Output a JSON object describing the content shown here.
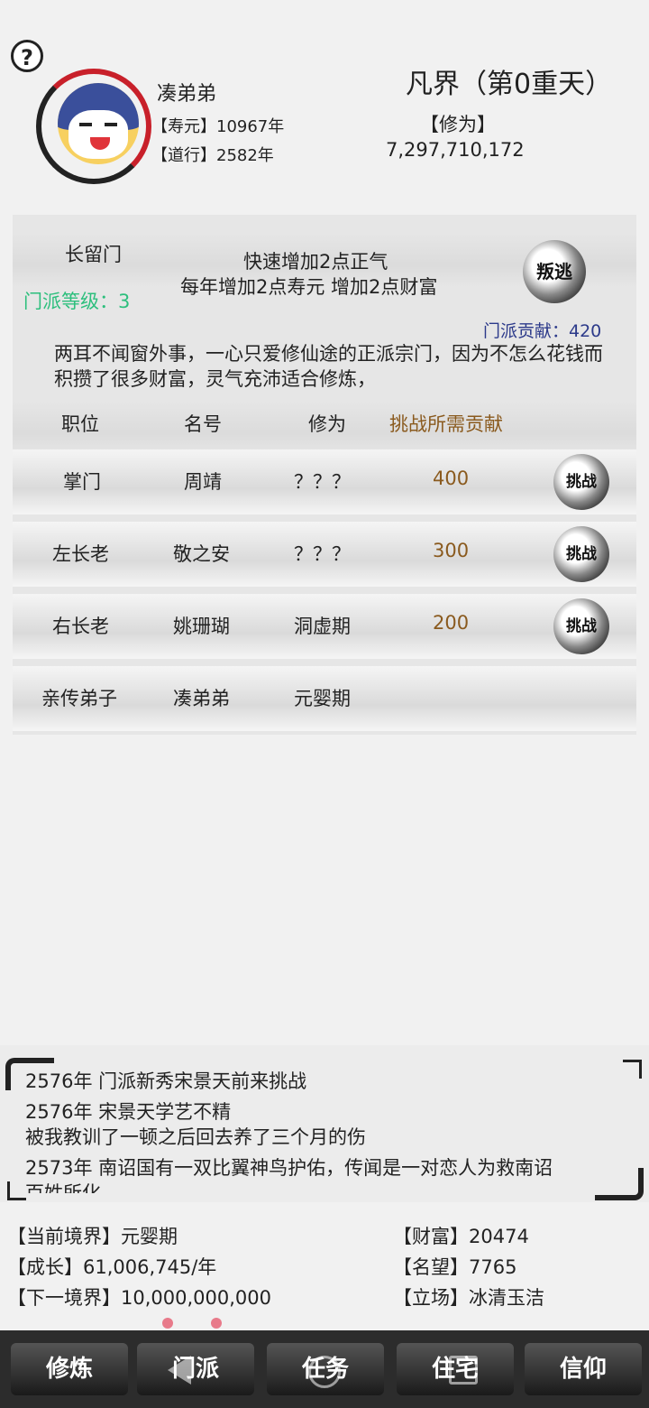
{
  "player": {
    "name": "凑弟弟",
    "lifespan_label": "【寿元】",
    "lifespan": "10967年",
    "dao_label": "【道行】",
    "dao": "2582年",
    "realm": "凡界（第0重天）",
    "cultivation_label": "【修为】",
    "cultivation": "7,297,710,172"
  },
  "help": {
    "icon": "?"
  },
  "sect": {
    "name": "长留门",
    "level_label": "门派等级：3",
    "bonus_line1": "快速增加2点正气",
    "bonus_line2": "每年增加2点寿元 增加2点财富",
    "betray_label": "叛逃",
    "contribution_label": "门派贡献：420",
    "description": "两耳不闻窗外事，一心只爱修仙途的正派宗门，因为不怎么花钱而积攒了很多财富，灵气充沛适合修炼，",
    "columns": [
      "职位",
      "名号",
      "修为",
      "挑战所需贡献"
    ],
    "challenge_label": "挑战",
    "rows": [
      {
        "position": "掌门",
        "name": "周靖",
        "cultivation": "？？？",
        "cost": "400",
        "challenge": true
      },
      {
        "position": "左长老",
        "name": "敬之安",
        "cultivation": "？？？",
        "cost": "300",
        "challenge": true
      },
      {
        "position": "右长老",
        "name": "姚珊瑚",
        "cultivation": "洞虚期",
        "cost": "200",
        "challenge": true
      },
      {
        "position": "亲传弟子",
        "name": "凑弟弟",
        "cultivation": "元婴期",
        "cost": "",
        "challenge": false
      }
    ]
  },
  "log": [
    "2576年 门派新秀宋景天前来挑战",
    "2576年 宋景天学艺不精",
    "被我教训了一顿之后回去养了三个月的伤",
    "2573年 南诏国有一双比翼神鸟护佑，传闻是一对恋人为救南诏",
    "百姓所化"
  ],
  "stats": {
    "current_realm": "【当前境界】元婴期",
    "growth": "【成长】61,006,745/年",
    "next_realm": "【下一境界】10,000,000,000",
    "wealth": "【财富】20474",
    "reputation": "【名望】7765",
    "stance": "【立场】冰清玉洁"
  },
  "nav": [
    "修炼",
    "门派",
    "任务",
    "住宅",
    "信仰"
  ],
  "colors": {
    "level": "#2dbf7d",
    "contribution": "#2c3a8a",
    "cost": "#8a5a1e",
    "ring": "#c8202a"
  }
}
